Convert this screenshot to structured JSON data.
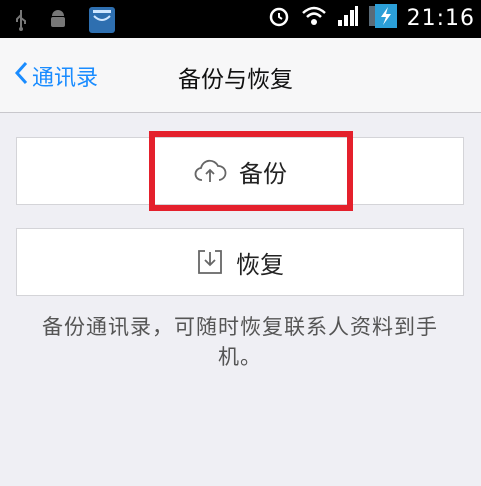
{
  "status_bar": {
    "time": "21:16",
    "left_icons": [
      "usb-icon",
      "android-icon",
      "shopping-bag-icon"
    ],
    "right_icons": [
      "alarm-icon",
      "wifi-icon",
      "signal-icon",
      "battery-charging-icon"
    ]
  },
  "nav": {
    "back_label": "通讯录",
    "title": "备份与恢复"
  },
  "actions": {
    "backup_label": "备份",
    "restore_label": "恢复"
  },
  "description": "备份通讯录，可随时恢复联系人资料到手机。",
  "colors": {
    "accent": "#1a8cff",
    "highlight": "#e4202c",
    "background": "#efeff4"
  }
}
